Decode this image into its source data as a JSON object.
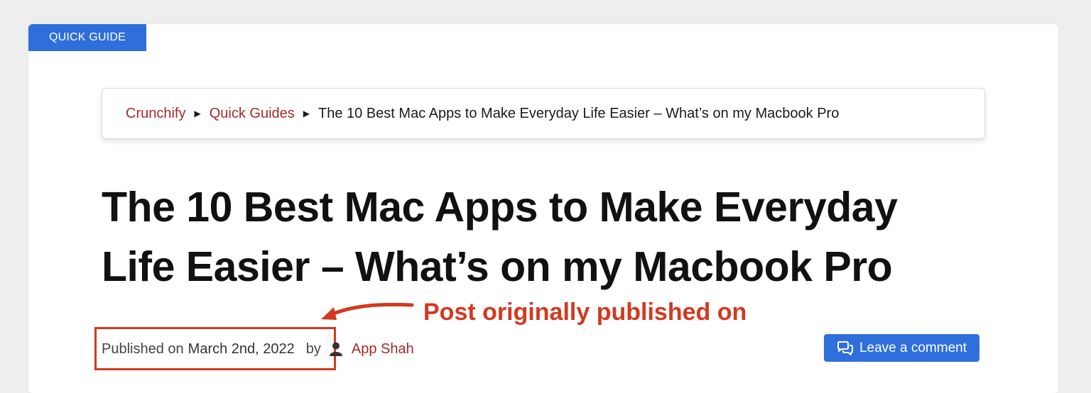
{
  "category": {
    "label": "QUICK GUIDE"
  },
  "breadcrumb": {
    "items": [
      {
        "label": "Crunchify"
      },
      {
        "label": "Quick Guides"
      },
      {
        "label": "The 10 Best Mac Apps to Make Everyday Life Easier – What’s on my Macbook Pro"
      }
    ],
    "separator_icon": "triangle-right-icon"
  },
  "article": {
    "title_line1": "The 10 Best Mac Apps to Make Everyday",
    "title_line2": "Life Easier – What’s on my Macbook Pro"
  },
  "annotation": {
    "text": "Post originally published on",
    "color": "#d2391f"
  },
  "meta": {
    "published_prefix": "Published on",
    "date": "March 2nd, 2022",
    "by": "by",
    "author_icon": "user-icon",
    "author": "App Shah"
  },
  "comment_button": {
    "label": "Leave a comment",
    "icon": "comments-icon"
  },
  "colors": {
    "accent_blue": "#2f6fdc",
    "link_red": "#a52a2a",
    "background": "#eeeeee"
  }
}
